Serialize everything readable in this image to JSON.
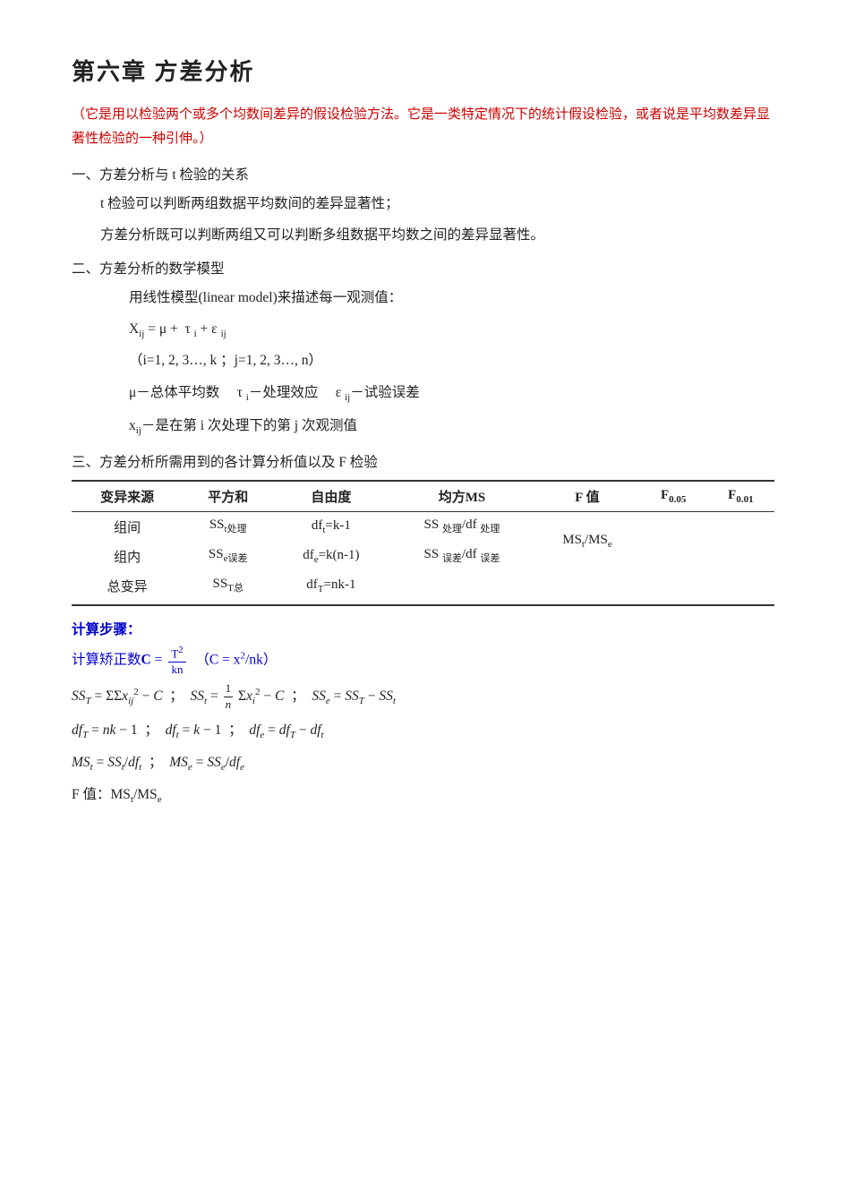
{
  "title": "第六章    方差分析",
  "intro": "（它是用以检验两个或多个均数间差异的假设检验方法。它是一类特定情况下的统计假设检验，或者说是平均数差异显著性检验的一种引伸。）",
  "section1": {
    "title": "一、方差分析与 t 检验的关系",
    "items": [
      "t 检验可以判断两组数据平均数间的差异显著性；",
      "方差分析既可以判断两组又可以判断多组数据平均数之间的差异显著性。"
    ]
  },
  "section2": {
    "title": "二、方差分析的数学模型",
    "model_intro": "用线性模型(linear model)来描述每一观测值：",
    "formula1": "X",
    "formula1_sub": "ij",
    "formula1_rest": "= μ +  τ ",
    "formula1_sub2": "i",
    "formula1_rest2": "+ ε ",
    "formula1_sub3": "ij",
    "condition": "（i=1, 2, 3…, k ；j=1, 2, 3…, n）",
    "explanation": "μ－总体平均数       τ ",
    "exp_sub1": "i",
    "explanation2": "－处理效应        ε ",
    "exp_sub2": "ij",
    "explanation3": "－试验误差",
    "obs_note": "x",
    "obs_sub": "ij",
    "obs_rest": "－是在第 i 次处理下的第 j 次观测值"
  },
  "section3": {
    "title": "三、方差分析所需用到的各计算分析值以及 F 检验",
    "table": {
      "headers": [
        "变异来源",
        "平方和",
        "自由度",
        "均方MS",
        "F 值",
        "F₀.₀₅",
        "F₀.₀₁"
      ],
      "rows": [
        {
          "source": "组间",
          "ss": "SS_t处理",
          "df": "df_t=k-1",
          "ms": "SS_处理/df_处理",
          "f": "MS_t/MS_e",
          "f005": "",
          "f001": ""
        },
        {
          "source": "组内",
          "ss": "SS_e误差",
          "df": "df_e=k(n-1)",
          "ms": "SS_误差/df_误差",
          "f": "",
          "f005": "",
          "f001": ""
        },
        {
          "source": "总变异",
          "ss": "SS_T总",
          "df": "df_T=nk-1",
          "ms": "",
          "f": "",
          "f005": "",
          "f001": ""
        }
      ]
    }
  },
  "calc": {
    "title": "计算步骤：",
    "step1": "计算矫正数",
    "step1_formula": "C = T²/kn  （C = x²/nk）",
    "step2": "SS_T = ΣΣx²ij − C  ；SS_t = (1/n)Σx_i² − C  ；SS_e = SS_T − SS_t",
    "step3": "df_T = nk − 1  ；df_t = k − 1  ；df_e = df_T − df_t",
    "step4": "MS_t = SS_t/df_t  ；MS_e = SS_e/df_e",
    "step5": "F 值：MS_t/MS_e"
  }
}
